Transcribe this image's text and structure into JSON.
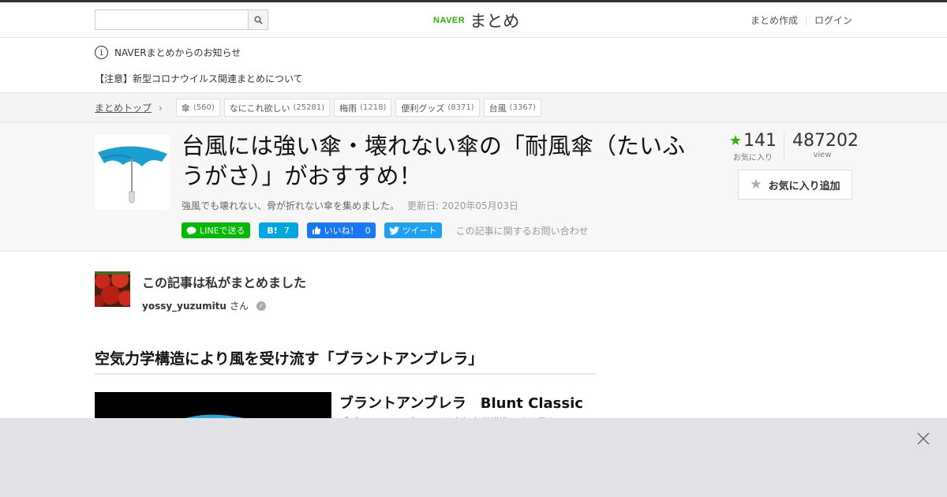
{
  "header": {
    "search_placeholder": "",
    "logo_brand": "NAVER",
    "logo_text": "まとめ",
    "links": [
      "まとめ作成",
      "ログイン"
    ]
  },
  "notice": {
    "heading": "NAVERまとめからのお知らせ",
    "link": "【注意】新型コロナウイルス関連まとめについて"
  },
  "breadcrumb": {
    "top_label": "まとめトップ",
    "tags": [
      {
        "label": "傘",
        "count": "(560)"
      },
      {
        "label": "なにこれ欲しい",
        "count": "(25281)"
      },
      {
        "label": "梅雨",
        "count": "(1218)"
      },
      {
        "label": "便利グッズ",
        "count": "(8371)"
      },
      {
        "label": "台風",
        "count": "(3367)"
      }
    ]
  },
  "article": {
    "title": "台風には強い傘・壊れない傘の「耐風傘（たいふうがさ）」がおすすめ！",
    "subtitle": "強風でも壊れない、骨が折れない傘を集めました。",
    "updated": "更新日: 2020年05月03日",
    "favorites": "141",
    "favorites_label": "お気に入り",
    "views": "487202",
    "views_label": "view",
    "fav_button": "お気に入り追加",
    "contact": "この記事に関するお問い合わせ"
  },
  "social": {
    "line": "LINEで送る",
    "hatena": "B!",
    "hatena_count": "7",
    "fb_like": "いいね！",
    "fb_count": "0",
    "tweet": "ツイート"
  },
  "author": {
    "heading": "この記事は私がまとめました",
    "name": "yossy_yuzumitu",
    "suffix": "さん"
  },
  "content": {
    "section_title": "空気力学構造により風を受け流す「ブラントアンブレラ」",
    "item_title": "ブラントアンブレラ　Blunt Classic",
    "item_desc": "「ブラントアンブレラ」は空気力学構造により風を"
  },
  "colors": {
    "brand_green": "#2db400",
    "line_green": "#00b900",
    "hatena_blue": "#00a4de",
    "fb_blue": "#1877f2",
    "twitter_blue": "#1da1f2"
  }
}
